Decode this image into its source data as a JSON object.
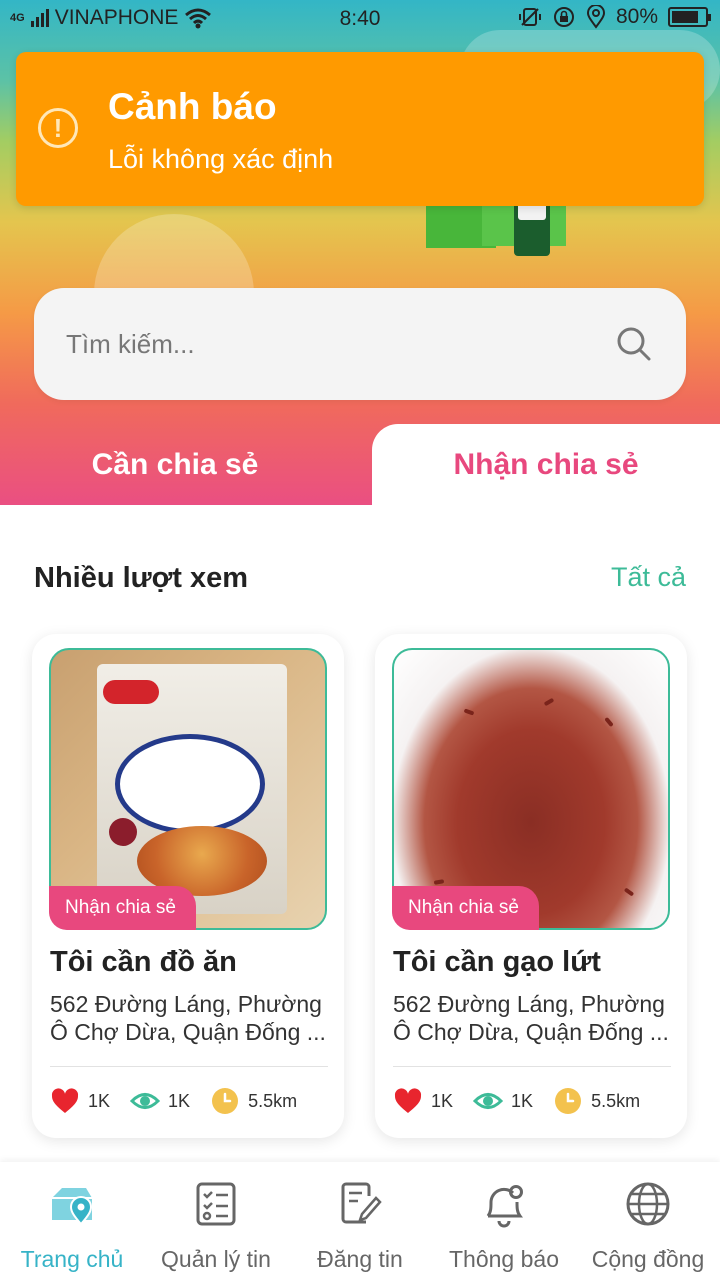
{
  "status_bar": {
    "network": "4G",
    "carrier": "VINAPHONE",
    "time": "8:40",
    "battery": "80%",
    "battery_level": 0.8
  },
  "toast": {
    "title": "Cảnh báo",
    "message": "Lỗi không xác định",
    "icon": "warning-icon",
    "color": "#ff9a00"
  },
  "search": {
    "placeholder": "Tìm kiếm...",
    "value": ""
  },
  "tabs": [
    {
      "label": "Cần chia sẻ",
      "active": false
    },
    {
      "label": "Nhận chia sẻ",
      "active": true
    }
  ],
  "section": {
    "title": "Nhiều lượt xem",
    "view_all": "Tất cả"
  },
  "cards": [
    {
      "badge": "Nhận chia sẻ",
      "title": "Tôi cần đồ ăn",
      "address_line1": "562 Đường Láng, Phường",
      "address_line2": "Ô Chợ Dừa, Quận Đống ...",
      "likes": "1K",
      "views": "1K",
      "distance": "5.5km"
    },
    {
      "badge": "Nhận chia sẻ",
      "title": "Tôi cần gạo lứt",
      "address_line1": "562 Đường Láng, Phường",
      "address_line2": "Ô Chợ Dừa, Quận Đống ...",
      "likes": "1K",
      "views": "1K",
      "distance": "5.5km"
    }
  ],
  "bottom_nav": [
    {
      "label": "Trang chủ",
      "icon": "home-pin-icon",
      "active": true
    },
    {
      "label": "Quản lý tin",
      "icon": "checklist-icon",
      "active": false
    },
    {
      "label": "Đăng tin",
      "icon": "edit-document-icon",
      "active": false
    },
    {
      "label": "Thông báo",
      "icon": "bell-icon",
      "active": false
    },
    {
      "label": "Cộng đồng",
      "icon": "globe-icon",
      "active": false
    }
  ],
  "colors": {
    "accent_pink": "#e8487e",
    "accent_green": "#3dbb98",
    "accent_blue": "#36b3c7",
    "warning": "#ff9a00"
  }
}
